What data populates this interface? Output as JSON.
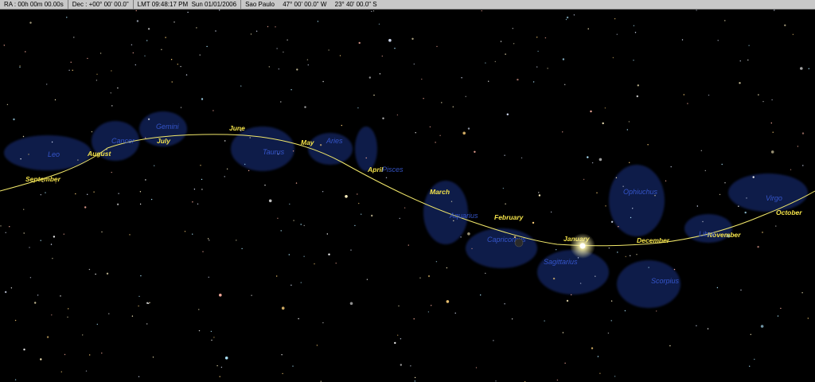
{
  "status": {
    "ra": "RA : 00h 00m 00.00s",
    "dec": "Dec : +00° 00' 00.0\"",
    "lmt": "LMT 09:48:17 PM",
    "date": "Sun 01/01/2006",
    "location": "Sao Paulo",
    "longitude": "47° 00' 00.0\" W",
    "latitude": "23° 40' 00.0\" S"
  },
  "months": [
    "September",
    "August",
    "July",
    "June",
    "May",
    "April",
    "March",
    "February",
    "January",
    "December",
    "November",
    "October"
  ],
  "constellations": [
    "Leo",
    "Cancer",
    "Gemini",
    "Taurus",
    "Aries",
    "Pisces",
    "Aquarius",
    "Capricornus",
    "Sagittarius",
    "Ophiuchus",
    "Scorpius",
    "Libra",
    "Virgo"
  ],
  "colors": {
    "ecliptic": "#f2e86a",
    "month_label": "#f4e34a",
    "constellation_art": "#2f4fd0",
    "sun": "#fffde0",
    "status_bar": "#c8c8c8"
  }
}
